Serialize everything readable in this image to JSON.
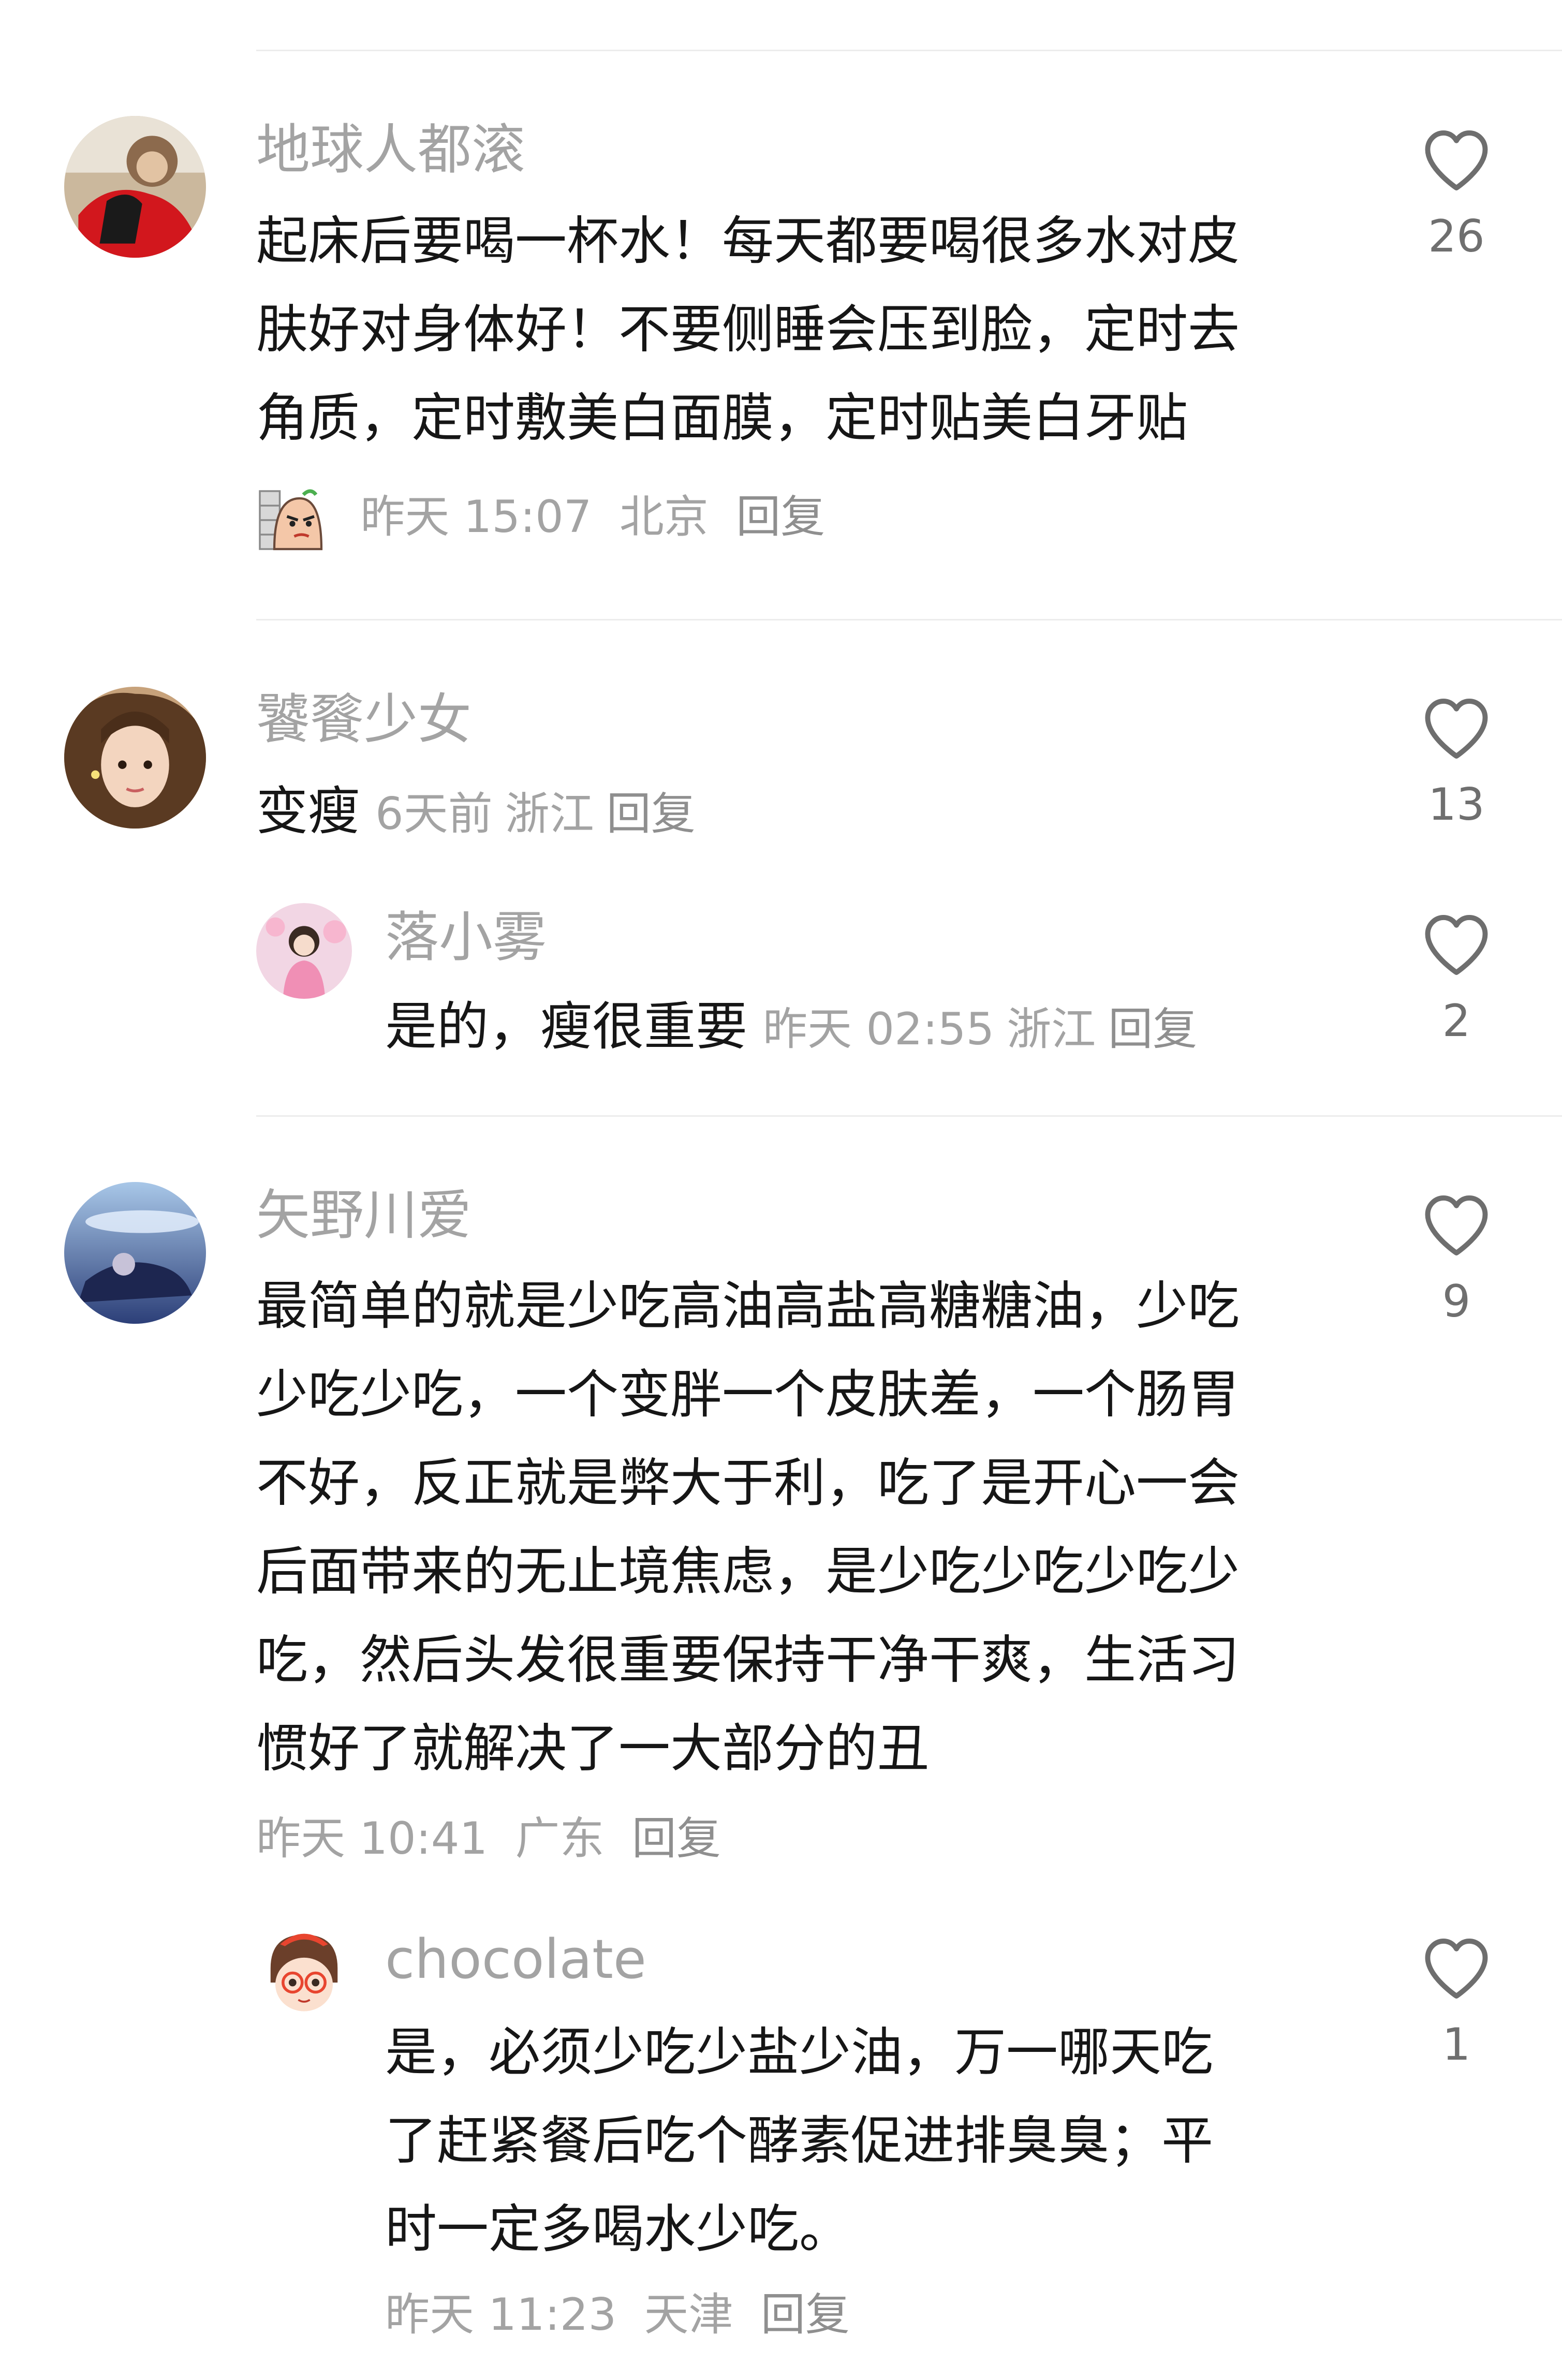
{
  "comments": [
    {
      "name": "地球人都滚",
      "lines": [
        "起床后要喝一杯水！每天都要喝很多水对皮",
        "肤好对身体好！不要侧睡会压到脸，定时去",
        "角质，定时敷美白面膜，定时贴美白牙贴"
      ],
      "time": "昨天 15:07",
      "location": "北京",
      "reply": "回复",
      "likes": "26",
      "sticker": "cartoon-sticker"
    },
    {
      "name": "饕餮少女",
      "text": "变瘦",
      "time": "6天前",
      "location": "浙江",
      "reply": "回复",
      "likes": "13",
      "replies": [
        {
          "name": "落小雾",
          "text": "是的，瘦很重要",
          "time": "昨天 02:55",
          "location": "浙江",
          "reply": "回复",
          "likes": "2"
        }
      ]
    },
    {
      "name": "矢野川爱",
      "lines": [
        "最简单的就是少吃高油高盐高糖糖油，少吃",
        "少吃少吃，一个变胖一个皮肤差，一个肠胃",
        "不好，反正就是弊大于利，吃了是开心一会",
        "后面带来的无止境焦虑，是少吃少吃少吃少",
        "吃，然后头发很重要保持干净干爽，生活习",
        "惯好了就解决了一大部分的丑"
      ],
      "time": "昨天 10:41",
      "location": "广东",
      "reply": "回复",
      "likes": "9",
      "replies": [
        {
          "name": "chocolate",
          "lines": [
            "是，必须少吃少盐少油，万一哪天吃",
            "了赶紧餐后吃个酵素促进排臭臭；平",
            "时一定多喝水少吃。"
          ],
          "time": "昨天 11:23",
          "location": "天津",
          "reply": "回复",
          "likes": "1"
        }
      ]
    }
  ],
  "icons": {
    "like": "heart-outline-icon"
  },
  "colors": {
    "name": "#a3a3a3",
    "text": "#161616",
    "meta": "#a3a3a3",
    "divider": "#ececec"
  }
}
